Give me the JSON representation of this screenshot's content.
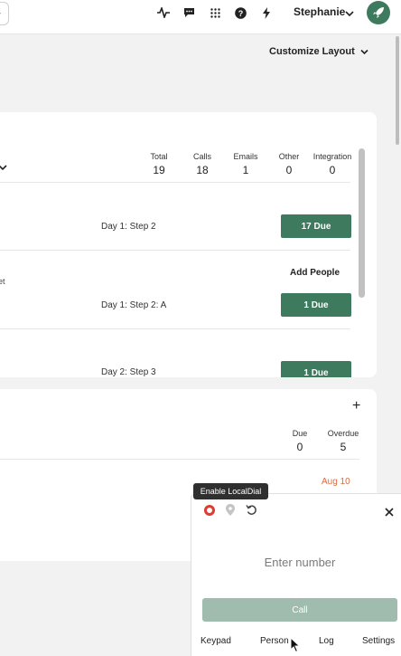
{
  "topbar": {
    "back_glyph": "›",
    "icons": [
      "activity-icon",
      "chat-icon",
      "grid-icon",
      "help-icon",
      "bolt-icon"
    ],
    "user_name": "Stephanie"
  },
  "customize": {
    "label": "Customize Layout"
  },
  "card1": {
    "stats": [
      {
        "label": "Total",
        "value": "19"
      },
      {
        "label": "Calls",
        "value": "18"
      },
      {
        "label": "Emails",
        "value": "1"
      },
      {
        "label": "Other",
        "value": "0"
      },
      {
        "label": "Integration",
        "value": "0"
      }
    ],
    "rows": [
      {
        "step": "Day 1: Step 2",
        "due": "17 Due"
      },
      {
        "step": "Day 1: Step 2: A",
        "due": "1 Due"
      },
      {
        "step": "Day 2: Step 3",
        "due": "1 Due"
      }
    ],
    "add_people": "Add People",
    "truncated_text": "et"
  },
  "card2": {
    "plus": "+",
    "stats": [
      {
        "label": "Due",
        "value": "0"
      },
      {
        "label": "Overdue",
        "value": "5"
      }
    ],
    "date": "Aug 10"
  },
  "dialer": {
    "tooltip": "Enable LocalDial",
    "placeholder": "Enter number",
    "call_label": "Call",
    "tabs": [
      "Keypad",
      "Person",
      "Log",
      "Settings"
    ]
  },
  "colors": {
    "accent_green": "#3e7a5e",
    "call_disabled": "#9fbcae",
    "record_red": "#e03b2f",
    "date_orange": "#e06a3c"
  }
}
